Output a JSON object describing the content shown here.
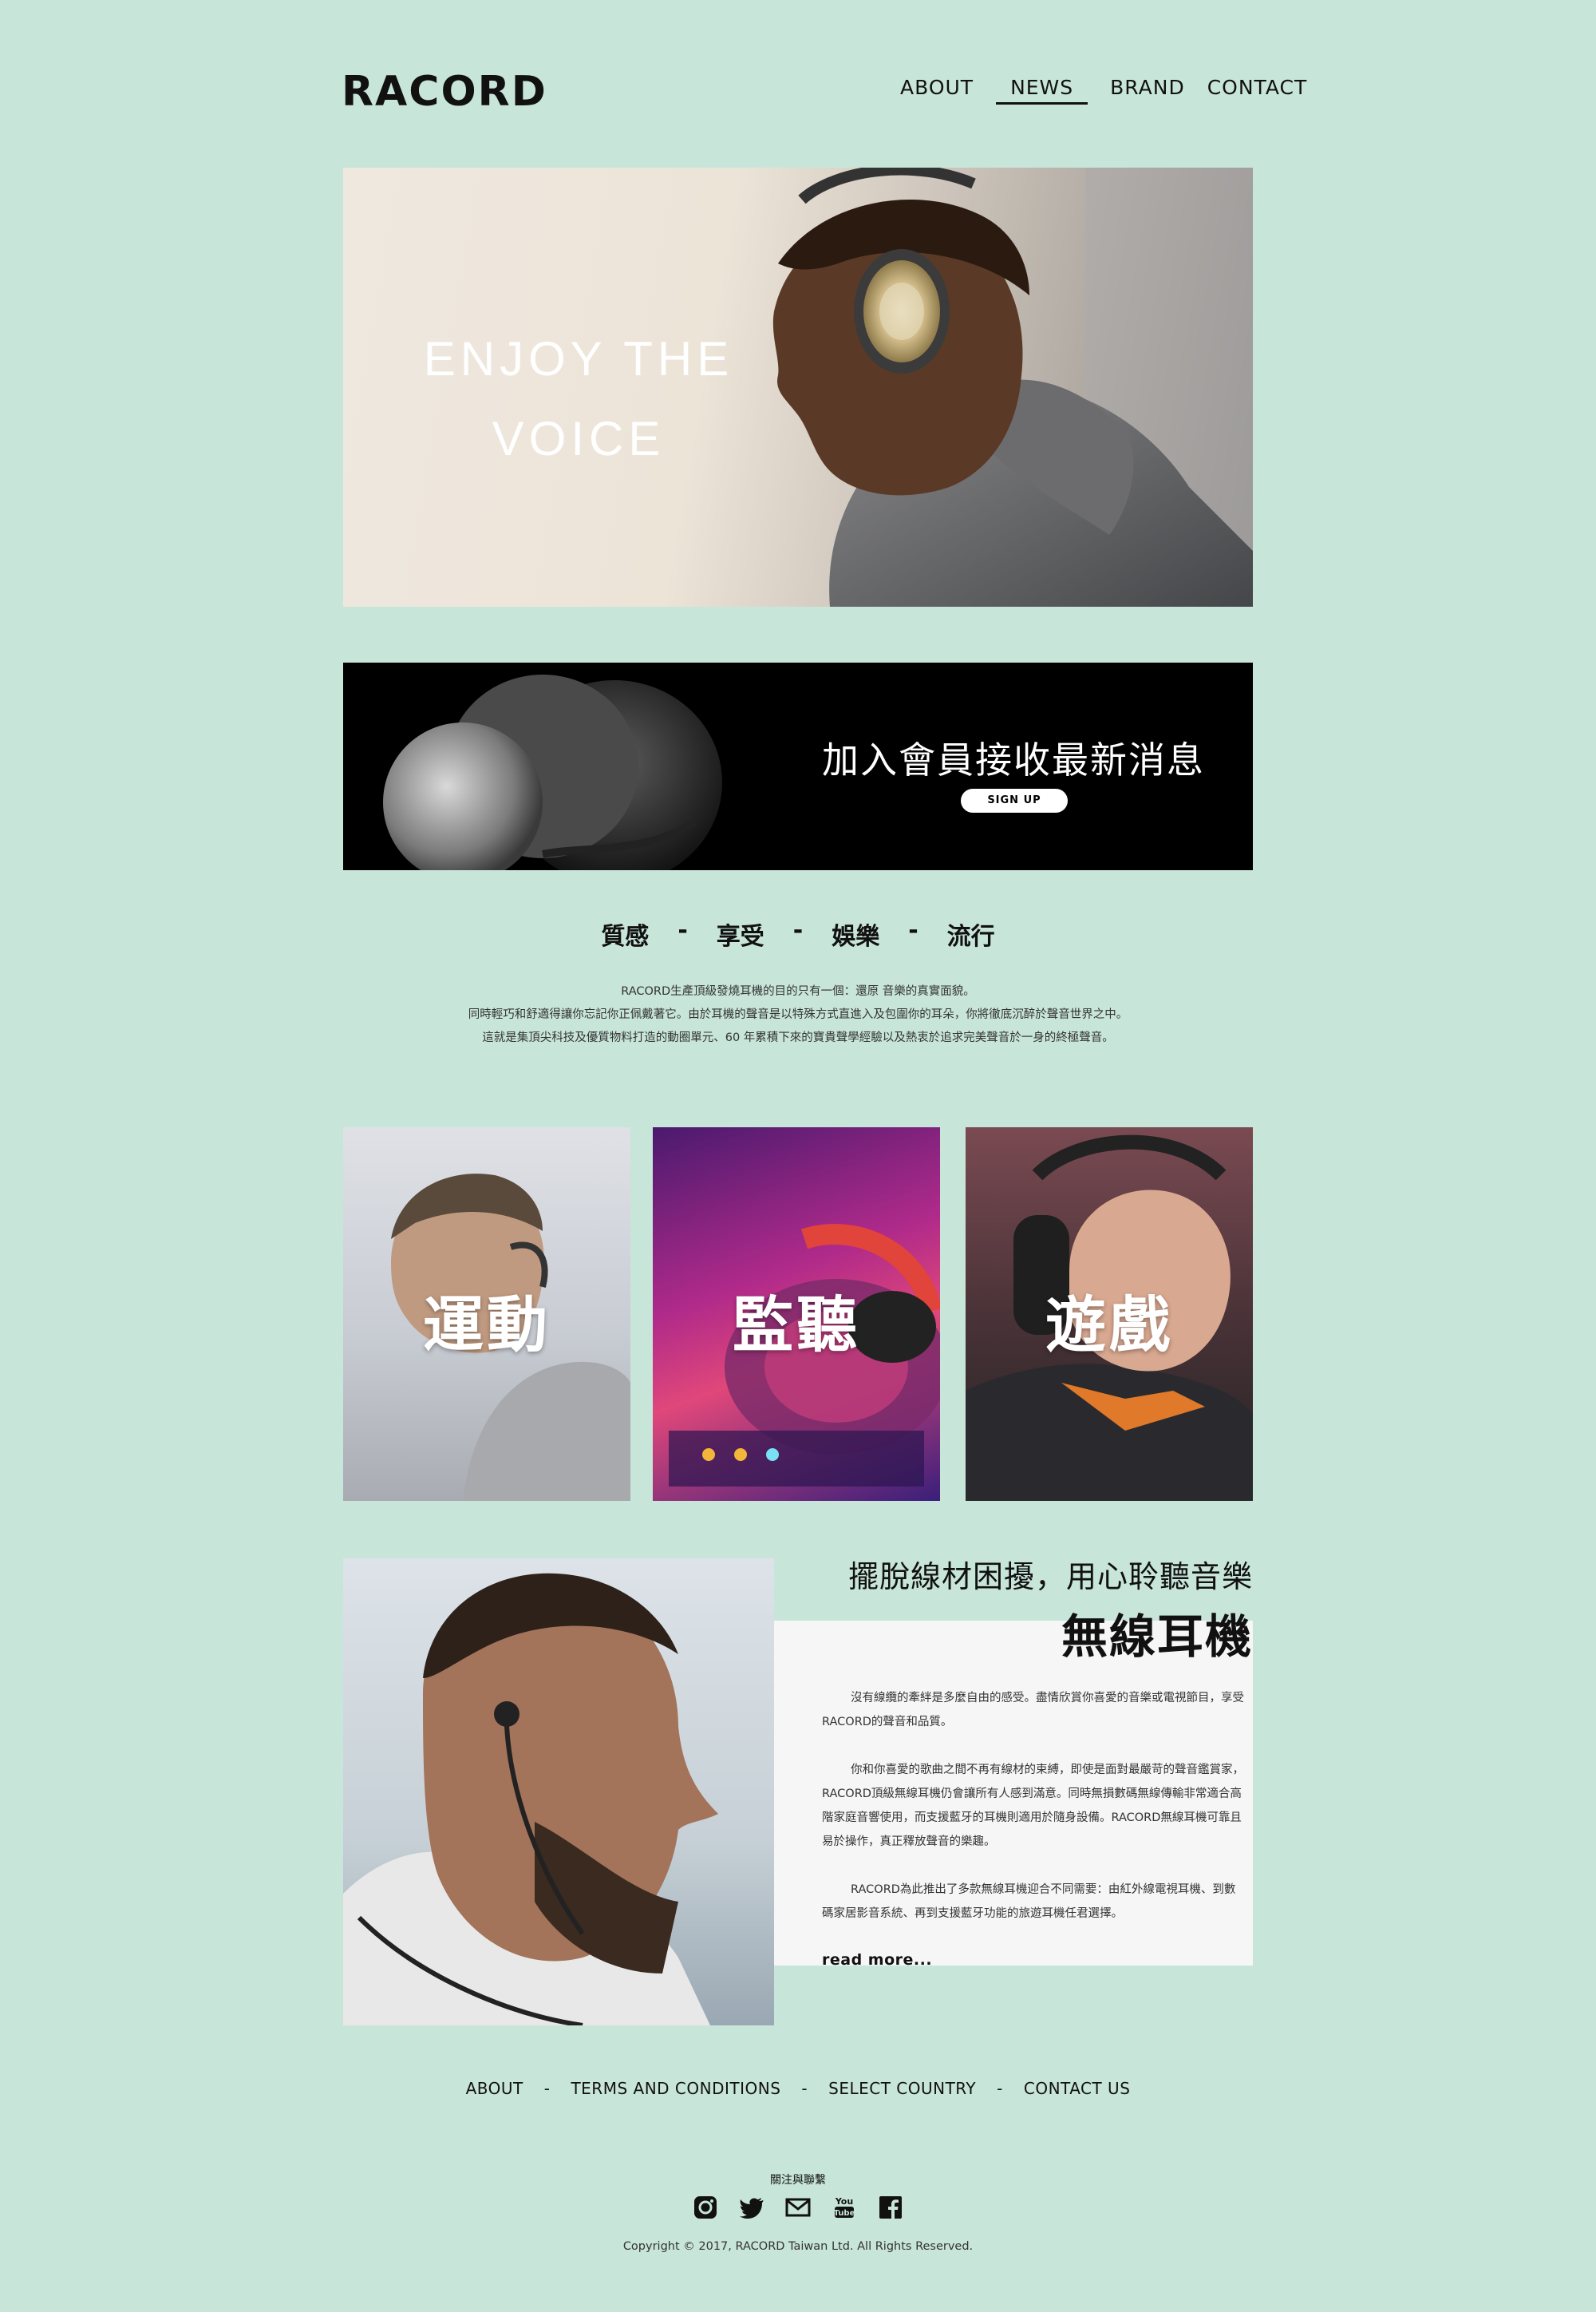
{
  "header": {
    "logo": "RACORD",
    "nav": [
      {
        "label": "ABOUT",
        "active": false
      },
      {
        "label": "NEWS",
        "active": true
      },
      {
        "label": "BRAND",
        "active": false
      },
      {
        "label": "CONTACT",
        "active": false
      }
    ]
  },
  "hero": {
    "line1": "ENJOY THE",
    "line2": "VOICE"
  },
  "banner": {
    "title": "加入會員接收最新消息",
    "button": "SIGN UP"
  },
  "tags": [
    "質感",
    "享受",
    "娛樂",
    "流行"
  ],
  "tag_separator": "-",
  "intro": [
    "RACORD生產頂級發燒耳機的目的只有一個：還原 音樂的真實面貌。",
    "同時輕巧和舒適得讓你忘記你正佩戴著它。由於耳機的聲音是以特殊方式直進入及包圍你的耳朵，你將徹底沉醉於聲音世界之中。",
    "這就是集頂尖科技及優質物料打造的動圈單元、60 年累積下來的寶貴聲學經驗以及熱衷於追求完美聲音於一身的終極聲音。"
  ],
  "categories": [
    {
      "label": "運動"
    },
    {
      "label": "監聽"
    },
    {
      "label": "遊戲"
    }
  ],
  "feature": {
    "subtitle": "擺脫線材困擾，用心聆聽音樂",
    "title": "無線耳機",
    "paragraphs": [
      "沒有線纜的牽絆是多麼自由的感受。盡情欣賞你喜愛的音樂或電視節目，享受RACORD的聲音和品質。",
      "你和你喜愛的歌曲之間不再有線材的束縛，即使是面對最嚴苛的聲音鑑賞家，RACORD頂級無線耳機仍會讓所有人感到滿意。同時無損數碼無線傳輸非常適合高階家庭音響使用，而支援藍牙的耳機則適用於隨身設備。RACORD無線耳機可靠且易於操作，真正釋放聲音的樂趣。",
      "RACORD為此推出了多款無線耳機迎合不同需要：由紅外線電視耳機、到數碼家居影音系統、再到支援藍牙功能的旅遊耳機任君選擇。"
    ],
    "read_more": "read more..."
  },
  "footer": {
    "links": [
      "ABOUT",
      "TERMS AND CONDITIONS",
      "SELECT COUNTRY",
      "CONTACT US"
    ],
    "separator": "-",
    "follow": "關注與聯繫",
    "social": [
      "instagram-icon",
      "twitter-icon",
      "mail-icon",
      "youtube-icon",
      "facebook-icon"
    ],
    "youtube_text": "You Tube",
    "copyright": "Copyright © 2017, RACORD Taiwan Ltd. All Rights Reserved."
  },
  "colors": {
    "background": "#c8e5da",
    "text": "#111111",
    "panel": "#f6f6f6"
  }
}
